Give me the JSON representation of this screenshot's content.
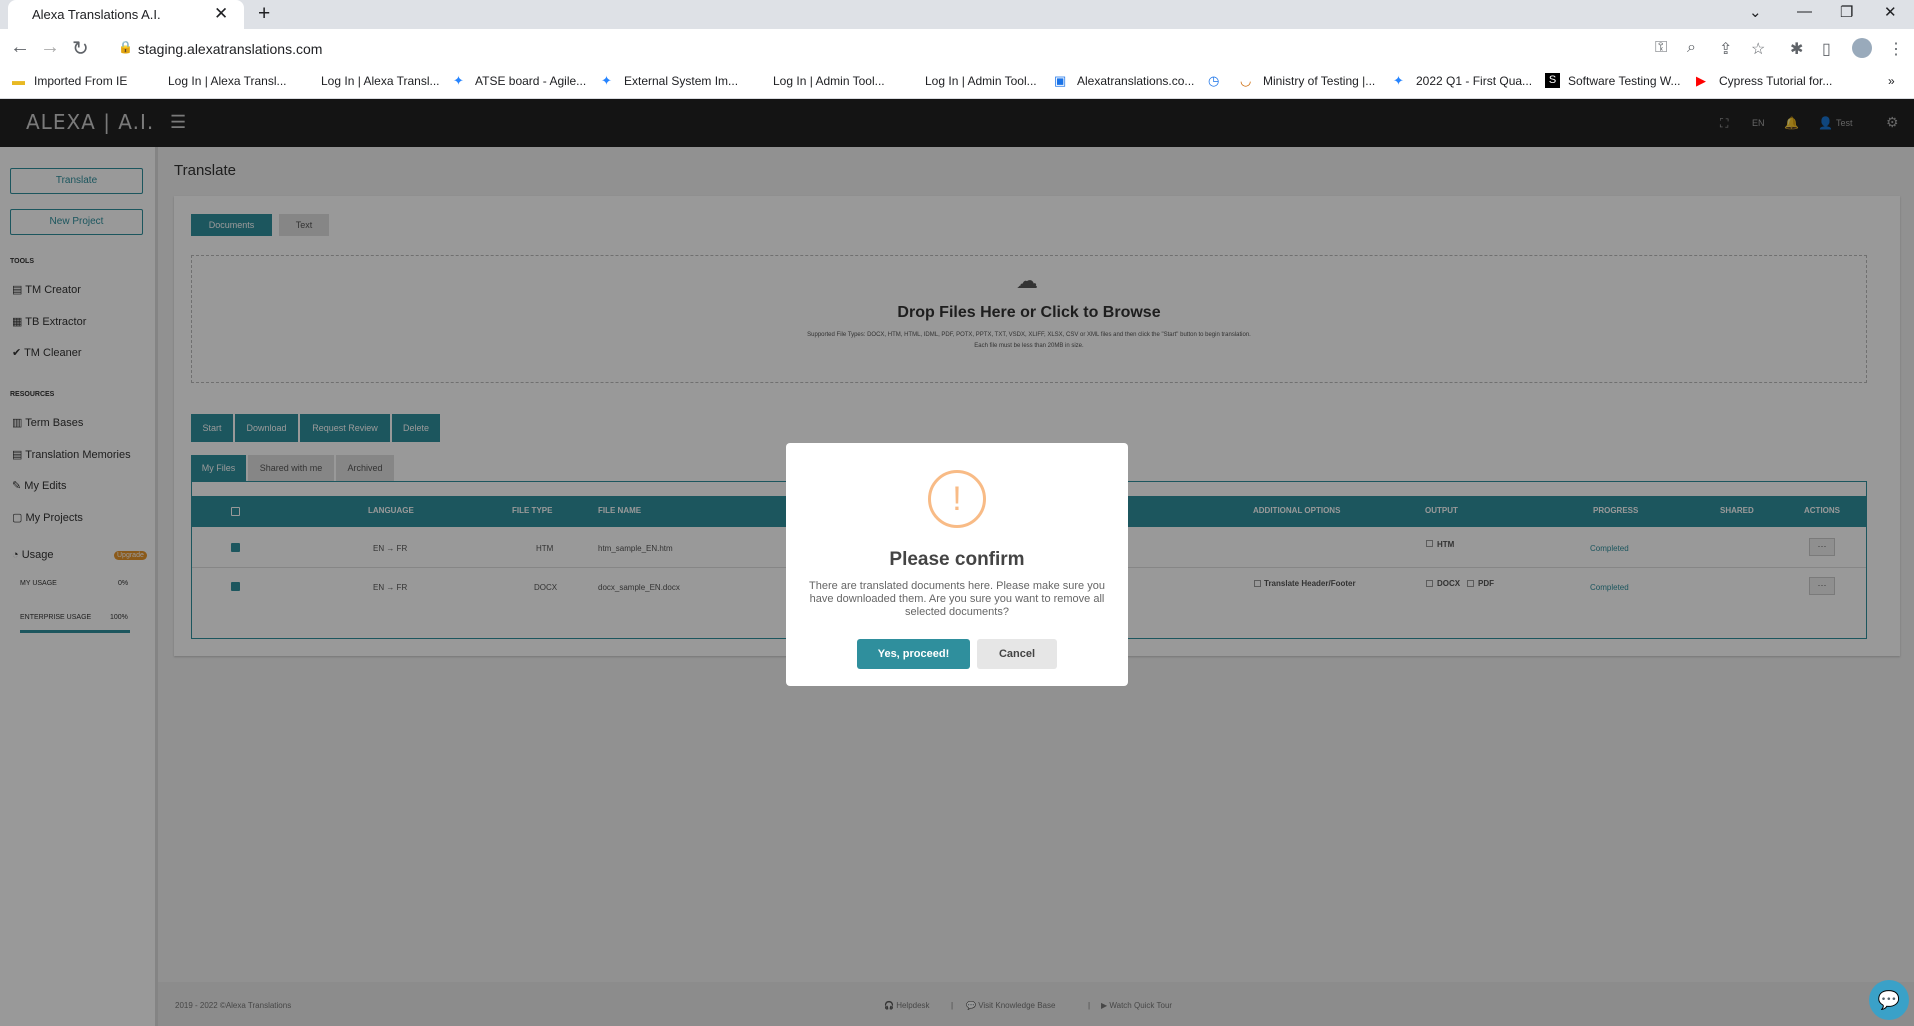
{
  "browser": {
    "tab_title": "Alexa Translations A.I.",
    "tab_close": "✕",
    "new_tab": "+",
    "url": "staging.alexatranslations.com",
    "bookmarks": [
      "Imported From IE",
      "Log In | Alexa Transl...",
      "Log In | Alexa Transl...",
      "ATSE board - Agile...",
      "External System Im...",
      "Log In | Admin Tool...",
      "Log In | Admin Tool...",
      "Alexatranslations.co...",
      "Ministry of Testing |...",
      "2022 Q1 - First Qua...",
      "Software Testing W...",
      "Cypress Tutorial for..."
    ]
  },
  "app": {
    "logo": "ALEXA | A.I.",
    "language": "EN",
    "user": "Test"
  },
  "sidebar": {
    "translate_button": "Translate",
    "new_project_button": "New Project",
    "tools_heading": "TOOLS",
    "tools": [
      "TM Creator",
      "TB Extractor",
      "TM Cleaner"
    ],
    "resources_heading": "RESOURCES",
    "resources": [
      "Term Bases",
      "Translation Memories",
      "My Edits",
      "My Projects"
    ],
    "usage_label": "Usage",
    "upgrade_badge": "Upgrade",
    "my_usage_label": "MY USAGE",
    "my_usage_value": "0%",
    "my_usage_fraction": 0,
    "enterprise_usage_label": "ENTERPRISE USAGE",
    "enterprise_usage_value": "100%",
    "enterprise_usage_fraction": 1
  },
  "main": {
    "page_title": "Translate",
    "mode_tabs": [
      "Documents",
      "Text"
    ],
    "drop_title": "Drop Files Here or Click to Browse",
    "drop_sub1": "Supported File Types: DOCX, HTM, HTML, IDML, PDF, POTX, PPTX, TXT, VSDX, XLIFF, XLSX, CSV or XML files and then click the \"Start\" button to begin translation.",
    "drop_sub2": "Each file must be less than 20MB in size.",
    "actions": [
      "Start",
      "Download",
      "Request Review",
      "Delete"
    ],
    "file_tabs": [
      "My Files",
      "Shared with me",
      "Archived"
    ],
    "table": {
      "headers": [
        "LANGUAGE",
        "FILE TYPE",
        "FILE NAME",
        "ADDITIONAL OPTIONS",
        "OUTPUT",
        "PROGRESS",
        "SHARED",
        "ACTIONS"
      ],
      "rows": [
        {
          "language": "EN → FR",
          "file_type": "HTM",
          "file_name": "htm_sample_EN.htm",
          "options": "",
          "output": [
            "HTM"
          ],
          "progress": "Completed",
          "action": "···"
        },
        {
          "language": "EN → FR",
          "file_type": "DOCX",
          "file_name": "docx_sample_EN.docx",
          "options": "Translate Header/Footer",
          "output": [
            "DOCX",
            "PDF"
          ],
          "progress": "Completed",
          "action": "···"
        }
      ]
    }
  },
  "footer": {
    "copyright": "2019 - 2022 ©Alexa Translations",
    "links": [
      "Helpdesk",
      "Visit Knowledge Base",
      "Watch Quick Tour"
    ],
    "separator": "|"
  },
  "modal": {
    "icon": "!",
    "title": "Please confirm",
    "message": "There are translated documents here. Please make sure you have downloaded them. Are you sure you want to remove all selected documents?",
    "confirm": "Yes, proceed!",
    "cancel": "Cancel"
  }
}
